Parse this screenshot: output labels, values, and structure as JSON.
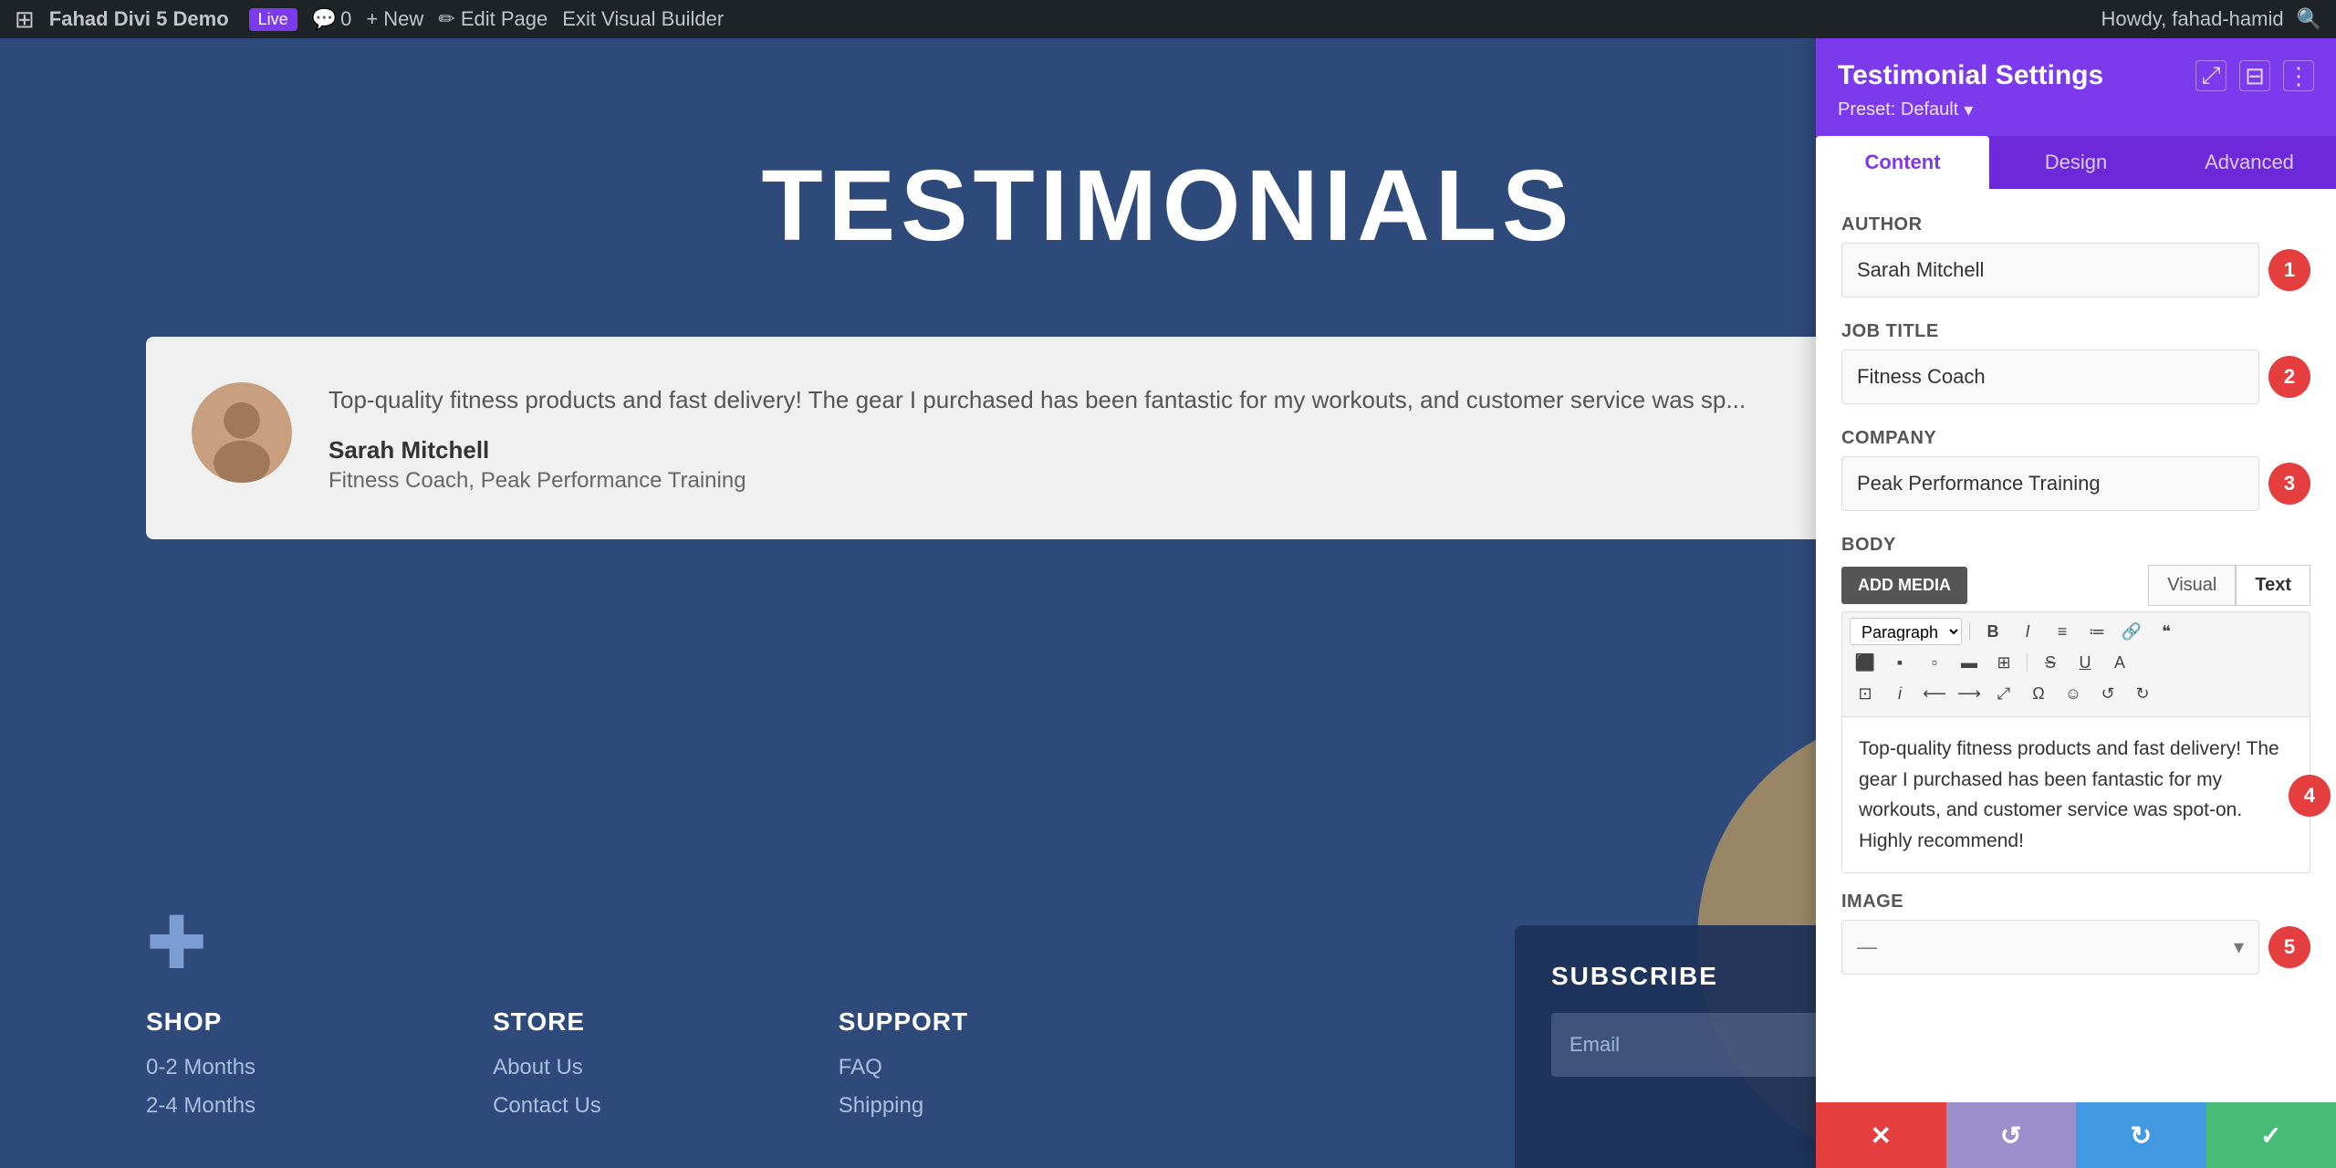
{
  "adminBar": {
    "wpLogo": "⊞",
    "siteName": "Fahad Divi 5 Demo",
    "liveBadge": "Live",
    "commentIcon": "💬",
    "commentCount": "0",
    "newLabel": "+ New",
    "editPageLabel": "✏ Edit Page",
    "exitBuilderLabel": "Exit Visual Builder",
    "howdy": "Howdy, fahad-hamid",
    "searchIcon": "🔍"
  },
  "page": {
    "testimonialsTitle": "TESTIMONIALS",
    "testimonial": {
      "text": "Top-quality fitness products and fast delivery! The gear I purchased has been fantastic for my workouts, and customer service was sp...",
      "authorName": "Sarah Mitchell",
      "authorRole": "Fitness Coach, Peak Performance Training"
    }
  },
  "footer": {
    "shop": {
      "heading": "SHOP",
      "links": [
        "0-2 Months",
        "2-4 Months"
      ]
    },
    "store": {
      "heading": "STORE",
      "links": [
        "About Us",
        "Contact Us"
      ]
    },
    "support": {
      "heading": "SUPPORT",
      "links": [
        "FAQ",
        "Shipping"
      ]
    },
    "subscribe": {
      "title": "SUBSCRIBE",
      "inputPlaceholder": "Email"
    }
  },
  "settingsPanel": {
    "title": "Testimonial Settings",
    "preset": "Preset: Default",
    "tabs": [
      "Content",
      "Design",
      "Advanced"
    ],
    "activeTab": "Content",
    "fields": {
      "author": {
        "label": "Author",
        "value": "Sarah Mitchell",
        "step": "1"
      },
      "jobTitle": {
        "label": "Job Title",
        "value": "Fitness Coach",
        "step": "2"
      },
      "company": {
        "label": "Company",
        "value": "Peak Performance Training",
        "step": "3"
      },
      "body": {
        "label": "Body",
        "addMediaBtn": "ADD MEDIA",
        "visualTab": "Visual",
        "textTab": "Text",
        "paragraphOption": "Paragraph",
        "content": "Top-quality fitness products and fast delivery! The gear I purchased has been fantastic for my workouts, and customer service was spot-on. Highly recommend!",
        "step": "4"
      },
      "image": {
        "label": "Image",
        "step": "5"
      }
    },
    "footer": {
      "cancelIcon": "✕",
      "resetIcon": "↺",
      "refreshIcon": "↻",
      "saveIcon": "✓"
    }
  }
}
